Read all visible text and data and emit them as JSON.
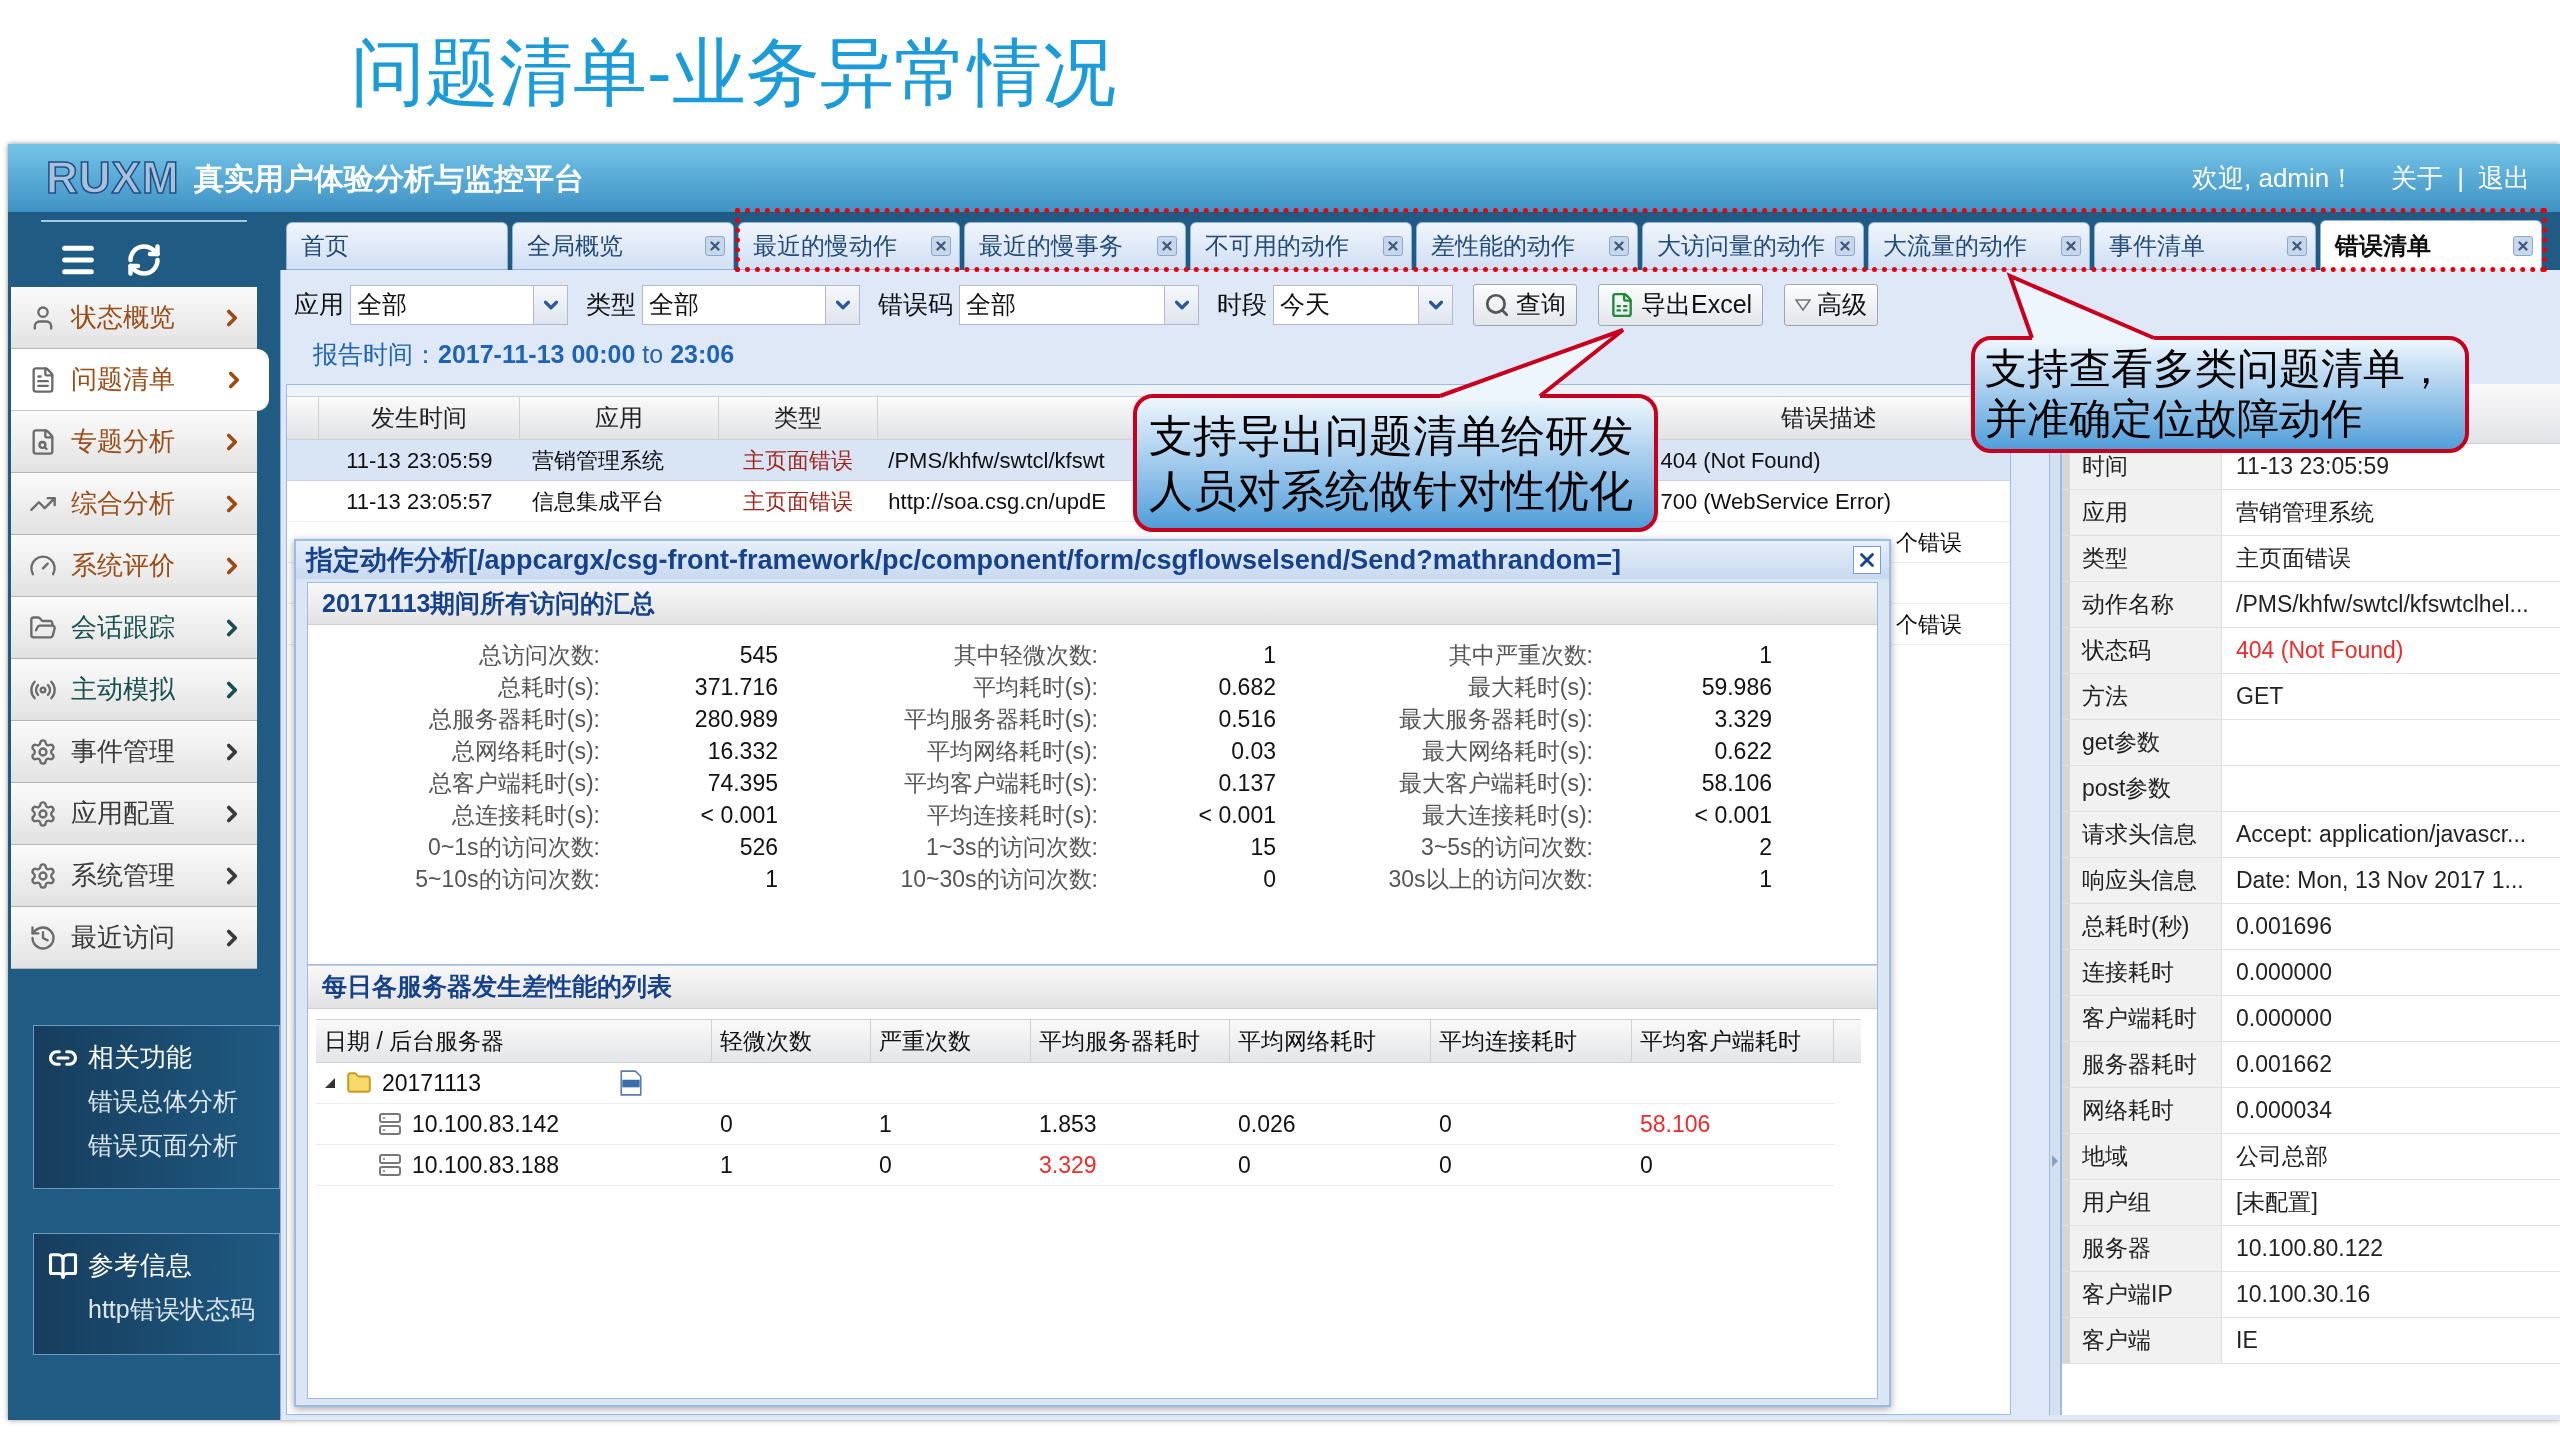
{
  "slide": {
    "title": "问题清单-业务异常情况"
  },
  "header": {
    "logo": "RUXM",
    "app_title": "真实用户体验分析与监控平台",
    "welcome": "欢迎, admin！",
    "links": [
      "关于",
      "退出"
    ],
    "separator": "|"
  },
  "sidebar": {
    "menu": [
      {
        "label": "状态概览",
        "selected": false,
        "color": "#9a4d16"
      },
      {
        "label": "问题清单",
        "selected": true,
        "color": "#9a4d16"
      },
      {
        "label": "专题分析",
        "selected": false,
        "color": "#9a4d16"
      },
      {
        "label": "综合分析",
        "selected": false,
        "color": "#9a4d16"
      },
      {
        "label": "系统评价",
        "selected": false,
        "color": "#9a4d16"
      },
      {
        "label": "会话跟踪",
        "selected": false,
        "color": "#175050"
      },
      {
        "label": "主动模拟",
        "selected": false,
        "color": "#175050"
      },
      {
        "label": "事件管理",
        "selected": false,
        "color": "#3a3a3a"
      },
      {
        "label": "应用配置",
        "selected": false,
        "color": "#3a3a3a"
      },
      {
        "label": "系统管理",
        "selected": false,
        "color": "#3a3a3a"
      },
      {
        "label": "最近访问",
        "selected": false,
        "color": "#3a3a3a"
      }
    ],
    "related": {
      "title": "相关功能",
      "links": [
        "错误总体分析",
        "错误页面分析"
      ]
    },
    "reference": {
      "title": "参考信息",
      "links": [
        "http错误状态码"
      ]
    }
  },
  "tabs": [
    {
      "label": "首页",
      "selected": false,
      "closable": false
    },
    {
      "label": "全局概览",
      "selected": false,
      "closable": true
    },
    {
      "label": "最近的慢动作",
      "selected": false,
      "closable": true
    },
    {
      "label": "最近的慢事务",
      "selected": false,
      "closable": true
    },
    {
      "label": "不可用的动作",
      "selected": false,
      "closable": true
    },
    {
      "label": "差性能的动作",
      "selected": false,
      "closable": true
    },
    {
      "label": "大访问量的动作",
      "selected": false,
      "closable": true
    },
    {
      "label": "大流量的动作",
      "selected": false,
      "closable": true
    },
    {
      "label": "事件清单",
      "selected": false,
      "closable": true
    },
    {
      "label": "错误清单",
      "selected": true,
      "closable": true
    }
  ],
  "filters": [
    {
      "label": "应用",
      "value": "全部"
    },
    {
      "label": "类型",
      "value": "全部"
    },
    {
      "label": "错误码",
      "value": "全部"
    },
    {
      "label": "时段",
      "value": "今天"
    }
  ],
  "buttons": [
    {
      "kind": "search",
      "label": "查询"
    },
    {
      "kind": "export",
      "label": "导出Excel"
    },
    {
      "kind": "advanced",
      "label": "高级"
    }
  ],
  "report_time": "报告时间：**2017-11-13 00:00** to **23:06**",
  "table": {
    "columns": {
      "time": "发生时间",
      "app": "应用",
      "type": "类型",
      "error": "错误描述"
    },
    "rows": [
      {
        "time": "11-13 23:05:59",
        "app": "营销管理系统",
        "type": "主页面错误",
        "action": "/PMS/khfw/swtcl/kfswt",
        "error": "404 (Not Found)",
        "selected": true
      },
      {
        "time": "11-13 23:05:57",
        "app": "信息集成平台",
        "type": "主页面错误",
        "action": "http://soa.csg.cn/updE",
        "error": "700 (WebService Error)",
        "selected": false
      },
      {
        "error": "个错误",
        "selected": false
      },
      {
        "selected": false
      },
      {
        "error": "个错误",
        "selected": false
      }
    ]
  },
  "detail": {
    "rows": [
      {
        "label": "时间",
        "value": "11-13 23:05:59",
        "alert": false
      },
      {
        "label": "应用",
        "value": "营销管理系统",
        "alert": false
      },
      {
        "label": "类型",
        "value": "主页面错误",
        "alert": false
      },
      {
        "label": "动作名称",
        "value": "/PMS/khfw/swtcl/kfswtclhel...",
        "alert": false
      },
      {
        "label": "状态码",
        "value": "404 (Not Found)",
        "alert": true
      },
      {
        "label": "方法",
        "value": "GET",
        "alert": false
      },
      {
        "label": "get参数"
      },
      {
        "label": "post参数"
      },
      {
        "label": "请求头信息",
        "value": "Accept: application/javascr...",
        "alert": false
      },
      {
        "label": "响应头信息",
        "value": "Date: Mon, 13 Nov 2017 1...",
        "alert": false
      },
      {
        "label": "总耗时(秒)",
        "value": "0.001696",
        "alert": false
      },
      {
        "label": "连接耗时",
        "value": "0.000000",
        "alert": false
      },
      {
        "label": "客户端耗时",
        "value": "0.000000",
        "alert": false
      },
      {
        "label": "服务器耗时",
        "value": "0.001662",
        "alert": false
      },
      {
        "label": "网络耗时",
        "value": "0.000034",
        "alert": false
      },
      {
        "label": "地域",
        "value": "公司总部",
        "alert": false
      },
      {
        "label": "用户组",
        "value": "[未配置]",
        "alert": false
      },
      {
        "label": "服务器",
        "value": "10.100.80.122",
        "alert": false
      },
      {
        "label": "客户端IP",
        "value": "10.100.30.16",
        "alert": false
      },
      {
        "label": "客户端",
        "value": "IE",
        "alert": false
      }
    ]
  },
  "dialog": {
    "title": "指定动作分析[/appcargx/csg-front-framework/pc/component/form/csgflowselsend/Send?mathrandom=]",
    "summary": {
      "title": "20171113期间所有访问的汇总",
      "stats": [
        [
          {
            "label": "总访问次数:",
            "value": "545"
          },
          {
            "label": "其中轻微次数:",
            "value": "1"
          },
          {
            "label": "其中严重次数:",
            "value": "1"
          }
        ],
        [
          {
            "label": "总耗时(s):",
            "value": "371.716"
          },
          {
            "label": "平均耗时(s):",
            "value": "0.682"
          },
          {
            "label": "最大耗时(s):",
            "value": "59.986"
          }
        ],
        [
          {
            "label": "总服务器耗时(s):",
            "value": "280.989"
          },
          {
            "label": "平均服务器耗时(s):",
            "value": "0.516"
          },
          {
            "label": "最大服务器耗时(s):",
            "value": "3.329"
          }
        ],
        [
          {
            "label": "总网络耗时(s):",
            "value": "16.332"
          },
          {
            "label": "平均网络耗时(s):",
            "value": "0.03"
          },
          {
            "label": "最大网络耗时(s):",
            "value": "0.622"
          }
        ],
        [
          {
            "label": "总客户端耗时(s):",
            "value": "74.395"
          },
          {
            "label": "平均客户端耗时(s):",
            "value": "0.137"
          },
          {
            "label": "最大客户端耗时(s):",
            "value": "58.106"
          }
        ],
        [
          {
            "label": "总连接耗时(s):",
            "value": "< 0.001"
          },
          {
            "label": "平均连接耗时(s):",
            "value": "< 0.001"
          },
          {
            "label": "最大连接耗时(s):",
            "value": "< 0.001"
          }
        ],
        [
          {
            "label": "0~1s的访问次数:",
            "value": "526"
          },
          {
            "label": "1~3s的访问次数:",
            "value": "15"
          },
          {
            "label": "3~5s的访问次数:",
            "value": "2"
          }
        ],
        [
          {
            "label": "5~10s的访问次数:",
            "value": "1"
          },
          {
            "label": "10~30s的访问次数:",
            "value": "0"
          },
          {
            "label": "30s以上的访问次数:",
            "value": "1"
          }
        ]
      ]
    },
    "servers": {
      "title": "每日各服务器发生差性能的列表",
      "columns": [
        "日期 / 后台服务器",
        "轻微次数",
        "严重次数",
        "平均服务器耗时",
        "平均网络耗时",
        "平均连接耗时",
        "平均客户端耗时"
      ],
      "tree": [
        {
          "label": "20171113",
          "expanded": true,
          "children": [
            {
              "label": "10.100.83.142",
              "cells": [
                {
                  "value": "0",
                  "alert": false
                },
                {
                  "value": "1",
                  "alert": false
                },
                {
                  "value": "1.853",
                  "alert": false
                },
                {
                  "value": "0.026",
                  "alert": false
                },
                {
                  "value": "0",
                  "alert": false
                },
                {
                  "value": "58.106",
                  "alert": true
                }
              ]
            },
            {
              "label": "10.100.83.188",
              "cells": [
                {
                  "value": "1",
                  "alert": false
                },
                {
                  "value": "0",
                  "alert": false
                },
                {
                  "value": "3.329",
                  "alert": true
                },
                {
                  "value": "0",
                  "alert": false
                },
                {
                  "value": "0",
                  "alert": false
                },
                {
                  "value": "0",
                  "alert": false
                }
              ]
            }
          ]
        }
      ]
    }
  },
  "callouts": [
    {
      "text": "支持导出问题清单给研发人员对系统做针对性优化"
    },
    {
      "text": "支持查看多类问题清单，并准确定位故障动作"
    }
  ]
}
